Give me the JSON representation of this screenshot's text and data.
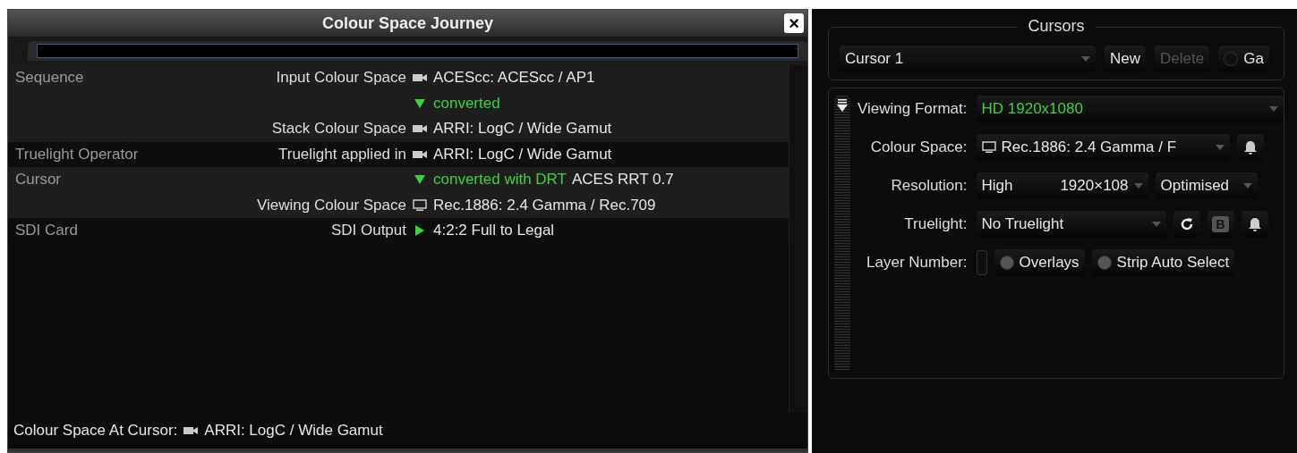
{
  "dialog": {
    "title": "Colour Space Journey",
    "close": "×",
    "sections": [
      {
        "name": "Sequence",
        "lines": [
          {
            "label": "Input Colour Space",
            "kind": "camera",
            "value": "ACEScc: ACEScc / AP1"
          },
          {
            "kind": "down",
            "note": "converted"
          },
          {
            "label": "Stack Colour Space",
            "kind": "camera",
            "value": "ARRI: LogC / Wide Gamut"
          }
        ]
      },
      {
        "name": "Truelight Operator",
        "lines": [
          {
            "label": "Truelight applied in",
            "kind": "camera",
            "value": "ARRI: LogC / Wide Gamut"
          }
        ]
      },
      {
        "name": "Cursor",
        "lines": [
          {
            "kind": "down",
            "note": "converted with DRT",
            "value": "ACES RRT 0.7"
          },
          {
            "label": "Viewing Colour Space",
            "kind": "monitor",
            "value": "Rec.1886: 2.4 Gamma / Rec.709"
          }
        ]
      },
      {
        "name": "SDI Card",
        "lines": [
          {
            "label": "SDI Output",
            "kind": "right",
            "value": "4:2:2 Full to Legal"
          }
        ]
      }
    ],
    "status": {
      "label": "Colour Space At Cursor:",
      "value": "ARRI: LogC / Wide Gamut"
    }
  },
  "cursors": {
    "title": "Cursors",
    "cursor_select": "Cursor 1",
    "buttons": [
      {
        "label": "New",
        "disabled": false,
        "kind": "button"
      },
      {
        "label": "Delete",
        "disabled": true,
        "kind": "button"
      },
      {
        "label": "Ga",
        "disabled": false,
        "kind": "toggle",
        "on": false
      }
    ],
    "settings": [
      {
        "label": "Viewing Format:",
        "kind": "format",
        "value": "HD 1920x1080"
      },
      {
        "label": "Colour Space:",
        "kind": "colour",
        "value": "Rec.1886: 2.4 Gamma / F"
      },
      {
        "label": "Resolution:",
        "kind": "resolution",
        "value": "High",
        "value_2": "1920×108",
        "value_3": "Optimised"
      },
      {
        "label": "Truelight:",
        "kind": "truelight",
        "value": "No Truelight",
        "badge": "B"
      },
      {
        "label": "Layer Number:",
        "kind": "layer",
        "toggles": [
          {
            "label": "Overlays",
            "on": false
          },
          {
            "label": "Strip Auto Select",
            "on": false
          }
        ]
      }
    ]
  }
}
